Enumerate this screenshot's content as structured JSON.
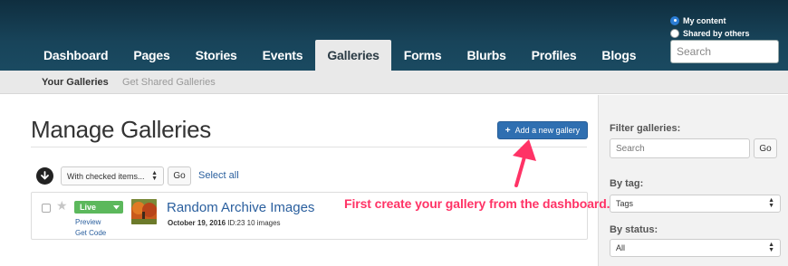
{
  "header": {
    "nav_tabs": [
      {
        "label": "Dashboard",
        "active": false
      },
      {
        "label": "Pages",
        "active": false
      },
      {
        "label": "Stories",
        "active": false
      },
      {
        "label": "Events",
        "active": false
      },
      {
        "label": "Galleries",
        "active": true
      },
      {
        "label": "Forms",
        "active": false
      },
      {
        "label": "Blurbs",
        "active": false
      },
      {
        "label": "Profiles",
        "active": false
      },
      {
        "label": "Blogs",
        "active": false
      }
    ],
    "content_filter": {
      "options": [
        {
          "label": "My content",
          "checked": true
        },
        {
          "label": "Shared by others",
          "checked": false
        }
      ]
    },
    "search": {
      "placeholder": "Search",
      "value": ""
    }
  },
  "subnav": {
    "items": [
      {
        "label": "Your Galleries",
        "active": true
      },
      {
        "label": "Get Shared Galleries",
        "active": false
      }
    ]
  },
  "main": {
    "title": "Manage Galleries",
    "add_button": {
      "label": "Add a new gallery",
      "icon": "plus-icon"
    },
    "bulk": {
      "select_value": "With checked items...",
      "go_label": "Go",
      "select_all_label": "Select all"
    },
    "galleries": [
      {
        "status": "Live",
        "preview_label": "Preview",
        "get_code_label": "Get Code",
        "title": "Random Archive Images",
        "date": "October 19, 2016",
        "meta": "ID:23 10 images"
      }
    ]
  },
  "sidebar": {
    "filter_label": "Filter galleries:",
    "search_placeholder": "Search",
    "go_label": "Go",
    "tag_label": "By tag:",
    "tag_value": "Tags",
    "status_label": "By status:",
    "status_value": "All"
  },
  "annotation": {
    "text": "First create your gallery from the dashboard.",
    "color": "#ff3366"
  },
  "colors": {
    "header_bg": "#18445a",
    "primary_button": "#2f6fb1",
    "live_green": "#5cb85c",
    "link": "#2a5f9e"
  }
}
